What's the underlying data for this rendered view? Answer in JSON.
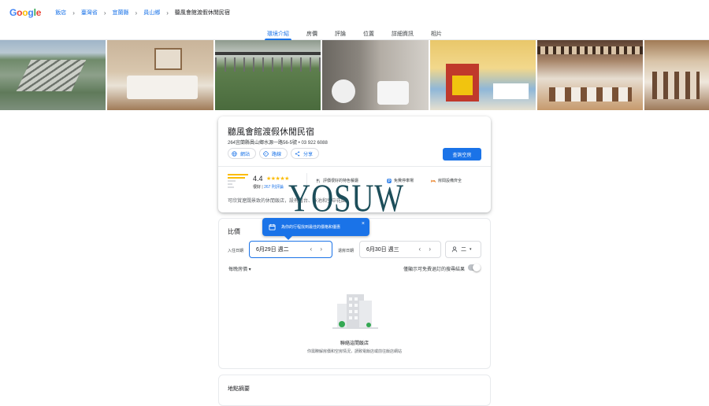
{
  "header": {
    "logo": [
      "G",
      "o",
      "o",
      "g",
      "l",
      "e"
    ],
    "logo_colors": [
      "#4285f4",
      "#ea4335",
      "#fbbc05",
      "#4285f4",
      "#34a853",
      "#ea4335"
    ],
    "breadcrumbs": [
      "飯店",
      "臺灣省",
      "宜蘭縣",
      "員山鄉",
      "聽風會館渡假休閒民宿"
    ]
  },
  "tabs": [
    "環境介紹",
    "房價",
    "評論",
    "位置",
    "詳細資訊",
    "相片"
  ],
  "hotel": {
    "name": "聽風會館渡假休閒民宿",
    "address": "264宜蘭縣員山鄉水源一路56-5號 • 03 922 6088",
    "actions": [
      "網站",
      "路線",
      "分享"
    ],
    "check_label": "查詢空房",
    "score": "4.4",
    "stars": "★★★★★",
    "score_word": "很好",
    "review_count": "267 則評論",
    "amenities": [
      "評價很好的特色餐廳",
      "免費停車場",
      "房間設備齊全"
    ],
    "description": "可欣賞遼闊景致的休閒飯店，設有露台、泳池和空中花園。"
  },
  "watermark": "YOSUW",
  "tooltip": {
    "text": "為你的行程找到最佳的價格和優惠",
    "close": "×"
  },
  "pricing": {
    "title": "比價",
    "checkin_label": "入住日期",
    "checkin_value": "6月29日 週二",
    "checkout_label": "退房日期",
    "checkout_value": "6月30日 週三",
    "guests": "二",
    "per_night": "每晚房價 ▾",
    "free_cancel": "僅顯示可免費退訂的搜尋結果",
    "empty_title": "聯絡這間飯店",
    "empty_sub": "你需瞭解房價和空房情況，請致電飯店或前往飯店網站"
  },
  "map": {
    "title": "地點摘要"
  }
}
